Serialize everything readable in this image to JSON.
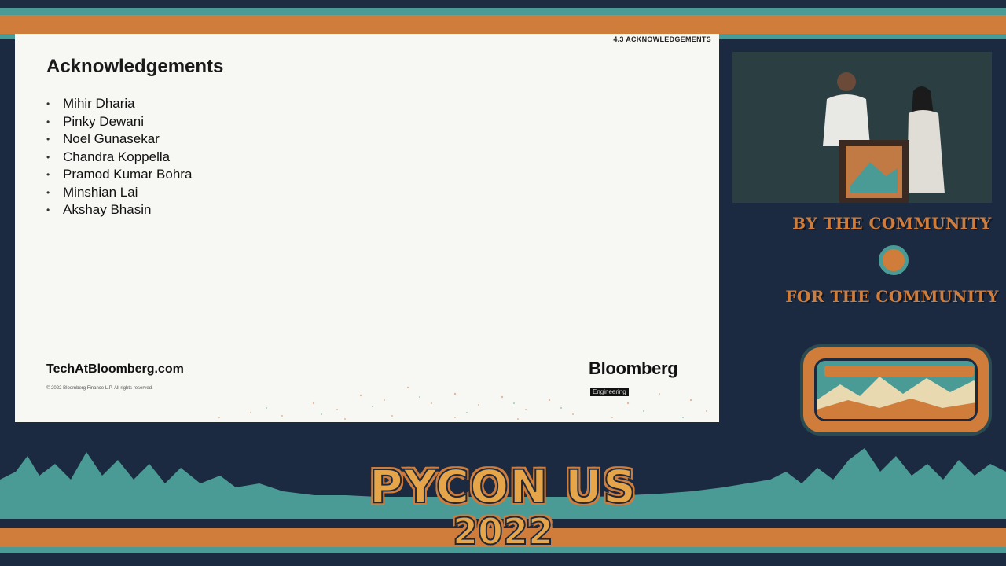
{
  "slide": {
    "section": "4.3 ACKNOWLEDGEMENTS",
    "title": "Acknowledgements",
    "names": [
      "Mihir Dharia",
      "Pinky Dewani",
      "Noel Gunasekar",
      "Chandra Koppella",
      "Pramod Kumar Bohra",
      "Minshian Lai",
      "Akshay Bhasin"
    ],
    "footer_link": "TechAtBloomberg.com",
    "copyright": "© 2022 Bloomberg Finance L.P. All rights reserved.",
    "logo": "Bloomberg",
    "logo_sub": "Engineering"
  },
  "sidebar": {
    "tagline_top": "BY THE COMMUNITY",
    "tagline_bottom": "FOR THE COMMUNITY"
  },
  "event": {
    "title": "PYCON US",
    "year": "2022"
  },
  "colors": {
    "navy": "#1b2a40",
    "teal": "#4a9b96",
    "orange": "#d07c3a",
    "slide_bg": "#f7f7f3"
  }
}
